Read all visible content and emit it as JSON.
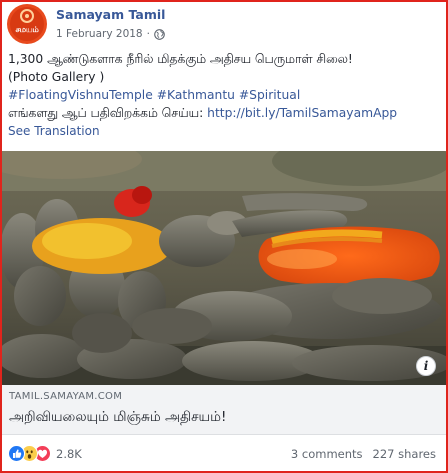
{
  "post": {
    "page_name": "Samayam Tamil",
    "date": "1 February 2018",
    "date_separator": "·",
    "avatar_text": "சமயம்",
    "text": {
      "line1": "1,300 ஆண்டுகளாக நீரில் மிதக்கும் அதிசய பெருமாள் சிலை!",
      "line2": "(Photo Gallery )",
      "hashtags": [
        "#FloatingVishnuTemple",
        "#Kathmantu",
        "#Spiritual"
      ],
      "line4_prefix": "எங்களது ஆப் பதிவிறக்கம் செய்ய: ",
      "app_link": "http://bit.ly/TamilSamayamApp",
      "see_translation": "See Translation"
    },
    "photo": {
      "info_label": "i"
    },
    "link_preview": {
      "domain": "TAMIL.SAMAYAM.COM",
      "title": "அறிவியலையும் மிஞ்சும் அதிசயம்!"
    },
    "footer": {
      "reactions": [
        "like-reaction-icon",
        "wow-reaction-icon",
        "love-reaction-icon"
      ],
      "reaction_count": "2.8K",
      "comments": "3 comments",
      "shares": "227 shares"
    }
  },
  "colors": {
    "brand_blue": "#385898",
    "frame_red": "#e0241c",
    "muted": "#606770",
    "like_blue": "#2078f4",
    "love_red": "#f33e58",
    "wow_yellow": "#fbcd4b"
  }
}
